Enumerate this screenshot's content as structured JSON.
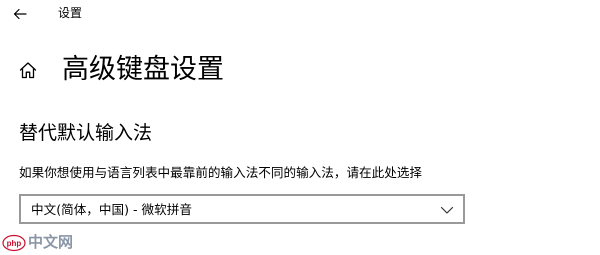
{
  "window": {
    "title": "设置"
  },
  "header": {
    "page_title": "高级键盘设置"
  },
  "section": {
    "heading": "替代默认输入法",
    "description": "如果你想使用与语言列表中最靠前的输入法不同的输入法，请在此处选择",
    "dropdown": {
      "selected": "中文(简体，中国) - 微软拼音"
    }
  },
  "watermark": {
    "text": "中文网",
    "logo_text": "php"
  },
  "icons": {
    "back": "back-arrow-icon",
    "home": "home-icon",
    "dropdown": "chevron-down-icon"
  },
  "colors": {
    "background": "#ffffff",
    "text": "#000000",
    "dropdown_border": "#999999",
    "watermark_red": "#c8102e",
    "watermark_gray": "#5a6a80"
  }
}
